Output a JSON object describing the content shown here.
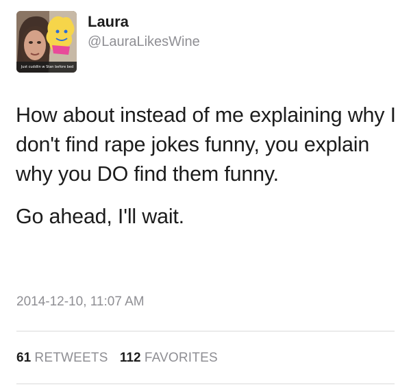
{
  "tweet": {
    "author": {
      "display_name": "Laura",
      "handle": "@LauraLikesWine",
      "avatar_caption": "Just cuddlin w Stan before bed"
    },
    "text_paragraphs": [
      "How about instead of me explaining why I don't find rape jokes funny, you explain why you DO find them funny.",
      "Go ahead, I'll wait."
    ],
    "timestamp": "2014-12-10, 11:07 AM",
    "stats": {
      "retweets_count": "61",
      "retweets_label": "RETWEETS",
      "favorites_count": "112",
      "favorites_label": "FAVORITES"
    }
  },
  "colors": {
    "text": "#1c1c1c",
    "muted": "#8e8e93",
    "divider": "#d9d9d9"
  }
}
